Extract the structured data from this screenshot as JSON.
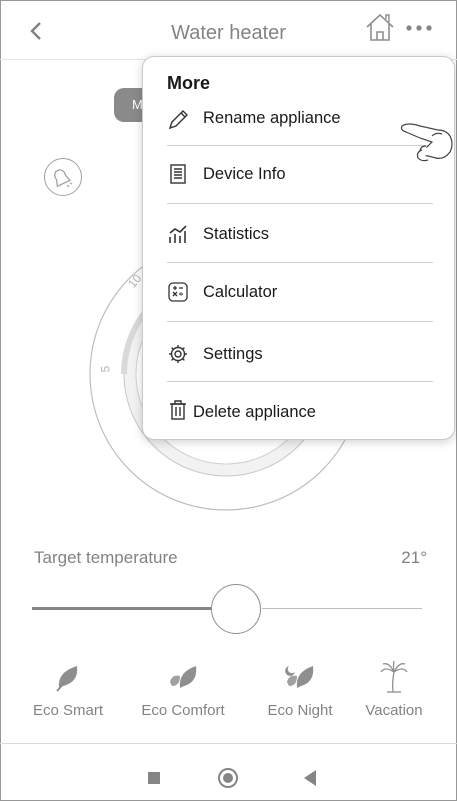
{
  "header": {
    "title": "Water heater",
    "back_icon": "chevron-left-icon",
    "home_icon": "home-icon",
    "more_icon": "more-dots-icon"
  },
  "background": {
    "mode_pill_text": "M",
    "dial_ticks": [
      "10",
      "5"
    ],
    "target_label": "Target temperature",
    "target_value": "21°",
    "slider_level": 0.48
  },
  "modes": [
    {
      "label": "Eco Smart",
      "icon": "leaf-icon"
    },
    {
      "label": "Eco Comfort",
      "icon": "leaves-icon"
    },
    {
      "label": "Eco Night",
      "icon": "leaves-night-icon"
    },
    {
      "label": "Vacation",
      "icon": "palm-tree-icon"
    }
  ],
  "menu": {
    "title": "More",
    "items": [
      {
        "label": "Rename appliance",
        "icon": "pencil-icon"
      },
      {
        "label": "Device Info",
        "icon": "document-icon"
      },
      {
        "label": "Statistics",
        "icon": "chart-icon"
      },
      {
        "label": "Calculator",
        "icon": "calculator-icon"
      },
      {
        "label": "Settings",
        "icon": "gear-icon"
      },
      {
        "label": "Delete appliance",
        "icon": "trash-icon"
      }
    ]
  },
  "navbar": {
    "items": [
      "recents-icon",
      "home-circle-icon",
      "back-triangle-icon"
    ]
  },
  "colors": {
    "text": "#1a1a1a",
    "pill_dark": "#2b2b2b",
    "menu_border": "#c9c9c9"
  }
}
